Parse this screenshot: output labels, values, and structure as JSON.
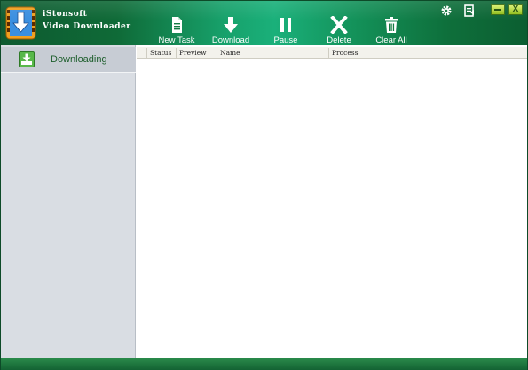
{
  "app": {
    "name_line1": "iStonsoft",
    "name_line2": "Video Downloader",
    "logo_icon": "film-download-logo"
  },
  "toolbar": {
    "items": [
      {
        "label": "New Task",
        "icon": "new-task-icon"
      },
      {
        "label": "Download",
        "icon": "download-arrow-icon"
      },
      {
        "label": "Pause",
        "icon": "pause-icon"
      },
      {
        "label": "Delete",
        "icon": "delete-x-icon"
      },
      {
        "label": "Clear All",
        "icon": "trash-icon"
      }
    ]
  },
  "system_buttons": {
    "settings_icon": "gear-icon",
    "register_icon": "register-doc-icon",
    "minimize_label": "",
    "close_label": "X"
  },
  "sidebar": {
    "items": [
      {
        "label": "Downloading",
        "icon": "download-tray-icon"
      }
    ]
  },
  "table": {
    "columns": [
      "Status",
      "Preview",
      "Name",
      "Process"
    ],
    "rows": []
  },
  "colors": {
    "titlebar_accent": "#1ab07a",
    "sidebar_bg": "#d9dde3",
    "statusbar": "#1a7040"
  }
}
